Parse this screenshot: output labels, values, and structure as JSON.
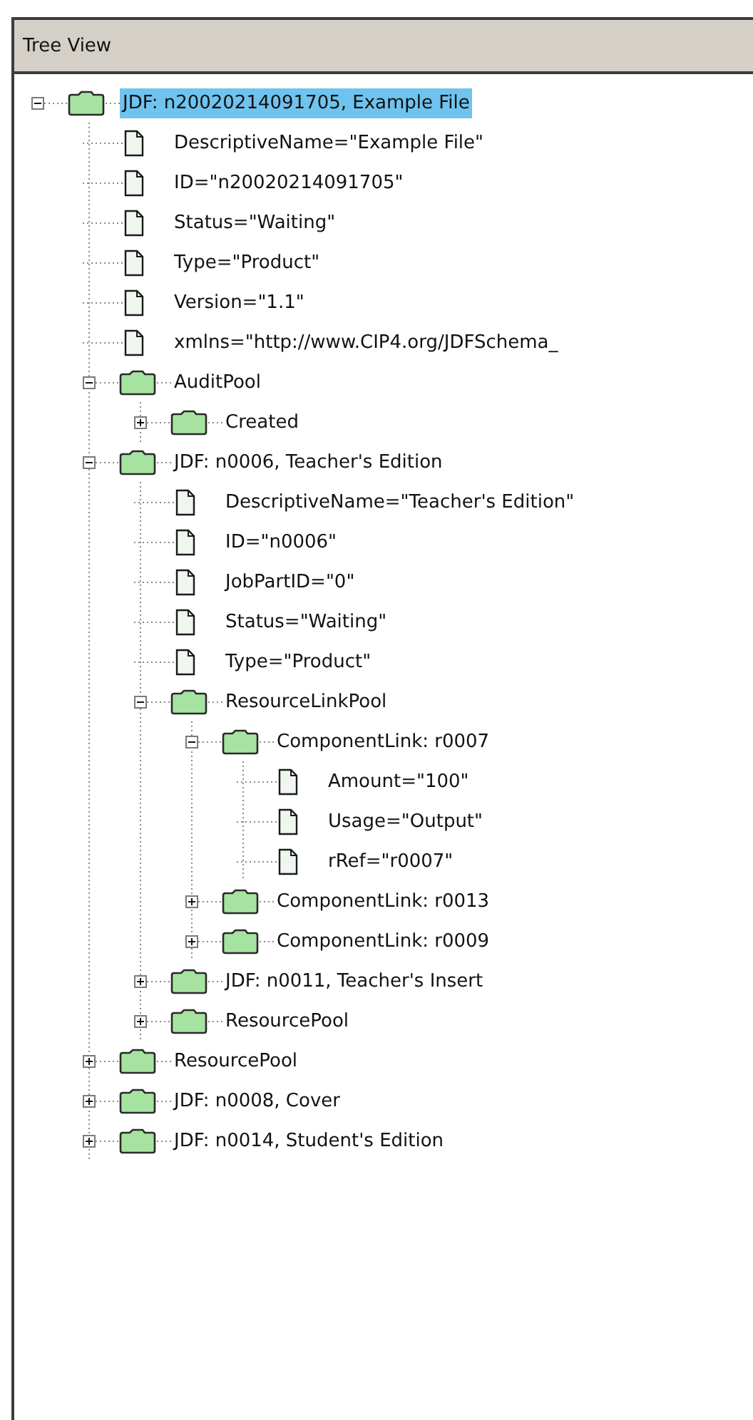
{
  "panel": {
    "title": "Tree View"
  },
  "tree": [
    {
      "kind": "folder",
      "label": "JDF: n20020214091705, Example File",
      "selected": true,
      "expanded": true,
      "children": [
        {
          "kind": "attribute",
          "label": "DescriptiveName=\"Example File\"",
          "selected": false
        },
        {
          "kind": "attribute",
          "label": "ID=\"n20020214091705\"",
          "selected": false
        },
        {
          "kind": "attribute",
          "label": "Status=\"Waiting\"",
          "selected": false
        },
        {
          "kind": "attribute",
          "label": "Type=\"Product\"",
          "selected": false
        },
        {
          "kind": "attribute",
          "label": "Version=\"1.1\"",
          "selected": false
        },
        {
          "kind": "attribute",
          "label": "xmlns=\"http://www.CIP4.org/JDFSchema_",
          "selected": false
        },
        {
          "kind": "folder",
          "label": "AuditPool",
          "selected": false,
          "expanded": true,
          "children": [
            {
              "kind": "folder",
              "label": "Created",
              "selected": false,
              "expanded": false
            }
          ]
        },
        {
          "kind": "folder",
          "label": "JDF: n0006, Teacher's Edition",
          "selected": false,
          "expanded": true,
          "children": [
            {
              "kind": "attribute",
              "label": "DescriptiveName=\"Teacher's Edition\"",
              "selected": false
            },
            {
              "kind": "attribute",
              "label": "ID=\"n0006\"",
              "selected": false
            },
            {
              "kind": "attribute",
              "label": "JobPartID=\"0\"",
              "selected": false
            },
            {
              "kind": "attribute",
              "label": "Status=\"Waiting\"",
              "selected": false
            },
            {
              "kind": "attribute",
              "label": "Type=\"Product\"",
              "selected": false
            },
            {
              "kind": "folder",
              "label": "ResourceLinkPool",
              "selected": false,
              "expanded": true,
              "children": [
                {
                  "kind": "folder",
                  "label": "ComponentLink: r0007",
                  "selected": false,
                  "expanded": true,
                  "children": [
                    {
                      "kind": "attribute",
                      "label": "Amount=\"100\"",
                      "selected": false
                    },
                    {
                      "kind": "attribute",
                      "label": "Usage=\"Output\"",
                      "selected": false
                    },
                    {
                      "kind": "attribute",
                      "label": "rRef=\"r0007\"",
                      "selected": false
                    }
                  ]
                },
                {
                  "kind": "folder",
                  "label": "ComponentLink: r0013",
                  "selected": false,
                  "expanded": false
                },
                {
                  "kind": "folder",
                  "label": "ComponentLink: r0009",
                  "selected": false,
                  "expanded": false
                }
              ]
            },
            {
              "kind": "folder",
              "label": "JDF: n0011, Teacher's Insert",
              "selected": false,
              "expanded": false
            },
            {
              "kind": "folder",
              "label": "ResourcePool",
              "selected": false,
              "expanded": false
            }
          ]
        },
        {
          "kind": "folder",
          "label": "ResourcePool",
          "selected": false,
          "expanded": false
        },
        {
          "kind": "folder",
          "label": "JDF: n0008, Cover",
          "selected": false,
          "expanded": false
        },
        {
          "kind": "folder",
          "label": "JDF: n0014, Student's Edition",
          "selected": false,
          "expanded": false
        }
      ]
    }
  ]
}
